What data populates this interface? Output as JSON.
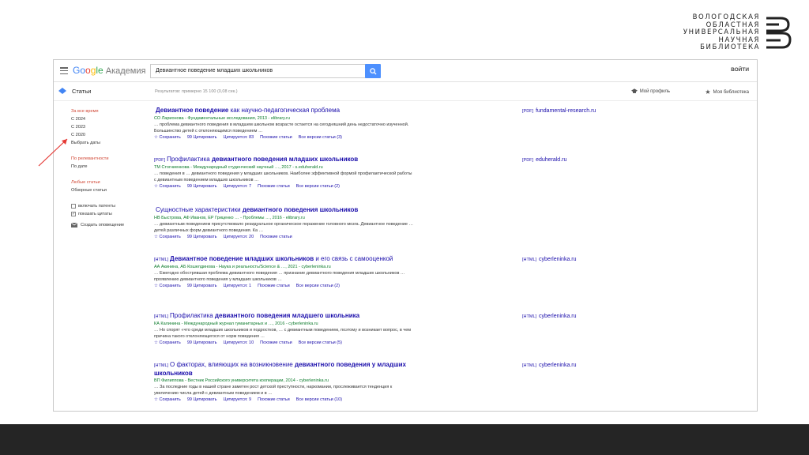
{
  "library": {
    "lines": [
      "ВОЛОГОДСКАЯ",
      "ОБЛАСТНАЯ",
      "УНИВЕРСАЛЬНАЯ",
      "НАУЧНАЯ",
      "БИБЛИОТЕКА"
    ]
  },
  "topbar": {
    "brand_g1": "Go",
    "brand_g2": "o",
    "brand_g3": "g",
    "brand_g4": "le",
    "brand_sub": "Академия",
    "search_value": "Девиантное поведение младших школьников",
    "signin": "ВОЙТИ"
  },
  "subbar": {
    "title": "Статьи",
    "results_count": "Результатов: примерно 15 100 (0,08 сек.)",
    "my_profile": "Мой профиль",
    "my_library": "Моя библиотека"
  },
  "filters": {
    "time_any": "За все время",
    "time_2024": "С 2024",
    "time_2023": "С 2023",
    "time_2020": "С 2020",
    "time_custom": "Выбрать даты",
    "sort_relevance": "По релевантности",
    "sort_date": "По дате",
    "lang_any": "Любые статьи",
    "lang_reviews": "Обзорные статьи",
    "include_patents": "включать патенты",
    "include_citations": "показать цитаты",
    "create_alert": "Создать оповещение"
  },
  "results": [
    {
      "type": "",
      "title_a": "Девиантное поведение",
      "title_b": " как научно-педагогическая проблема",
      "authors": "СО Ларионова - Фундаментальные исследования, 2013 - elibrary.ru",
      "snippet": "… проблема девиантного поведения в младшем школьном возрасте остается на сегодняшний день недостаточно изученной. Большинство детей с отклоняющимся поведением …",
      "cited": "Цитируется: 83",
      "similar": "Похожие статьи",
      "versions": "Все версии статьи (3)",
      "side_prefix": "[PDF]",
      "side": "fundamental-research.ru"
    },
    {
      "type": "[PDF]",
      "title_a": "Профилактика ",
      "title_b": "девиантного поведения младших школьников",
      "authors": "ТМ Стогниенкова - Международный студенческий научный …, 2017 - s.eduherald.ru",
      "snippet": "… поведения в … девиантного поведения у младших школьников. Наиболее эффективной формой профилактической работы с девиантным поведением младших школьников …",
      "cited": "Цитируется: 7",
      "similar": "Похожие статьи",
      "versions": "Все версии статьи (2)",
      "side_prefix": "[PDF]",
      "side": "eduherald.ru"
    },
    {
      "type": "",
      "title_a": "Сущностные характеристики ",
      "title_b": "девиантного поведения школьников",
      "authors": "НВ Быстрова, АФ Иванов, ЕР Гриценко … - Проблемы …, 2016 - elibrary.ru",
      "snippet": "… девиантным поведением присутствовало резидуальное органическое поражение головного мозга. Девиантное поведение … детей различных форм девиантного поведения. Ка …",
      "cited": "Цитируется: 20",
      "similar": "Похожие статьи",
      "versions": "",
      "side_prefix": "",
      "side": ""
    },
    {
      "type": "[HTML]",
      "title_a": "Девиантное поведение младших школьников",
      "title_b": " и его связь с самооценкой",
      "authors": "АА Акинина, АБ Кошелдинова - Наука и реальность/Science & …, 2021 - cyberleninka.ru",
      "snippet": "… Ежегодно обострявшая проблема девиантного поведения … признание девиантного поведения младших школьников … проявлению девиантного поведения у младших школьников …",
      "cited": "Цитируется: 1",
      "similar": "Похожие статьи",
      "versions": "Все версии статьи (2)",
      "side_prefix": "[HTML]",
      "side": "cyberleninka.ru"
    },
    {
      "type": "[HTML]",
      "title_a": "Профилактика ",
      "title_b": "девиантного поведения младшего школьника",
      "authors": "КА Калинина - Международный журнал гуманитарных и …, 2016 - cyberleninka.ru",
      "snippet": "… Но спорят «что среди младших школьников и подростков, … с девиантным поведением, поэтому и возникает вопрос, в чем причина такого отклоняющегося от норм поведения …",
      "cited": "Цитируется: 10",
      "similar": "Похожие статьи",
      "versions": "Все версии статьи (5)",
      "side_prefix": "[HTML]",
      "side": "cyberleninka.ru"
    },
    {
      "type": "[HTML]",
      "title_a": "О факторах, влияющих на возникновение ",
      "title_b": "девиантного поведения у младших школьников",
      "authors": "ВП Филиппова - Вестник Российского университета кооперации, 2014 - cyberleninka.ru",
      "snippet": "… За последние годы в нашей стране заметен рост детской преступности, наркомании, прослеживается тенденция к увеличению числа детей с девиантным поведением и в …",
      "cited": "Цитируется: 9",
      "similar": "Похожие статьи",
      "versions": "Все версии статьи (10)",
      "side_prefix": "[HTML]",
      "side": "cyberleninka.ru"
    }
  ],
  "actions": {
    "save": "Сохранить",
    "cite": "Цитировать"
  }
}
